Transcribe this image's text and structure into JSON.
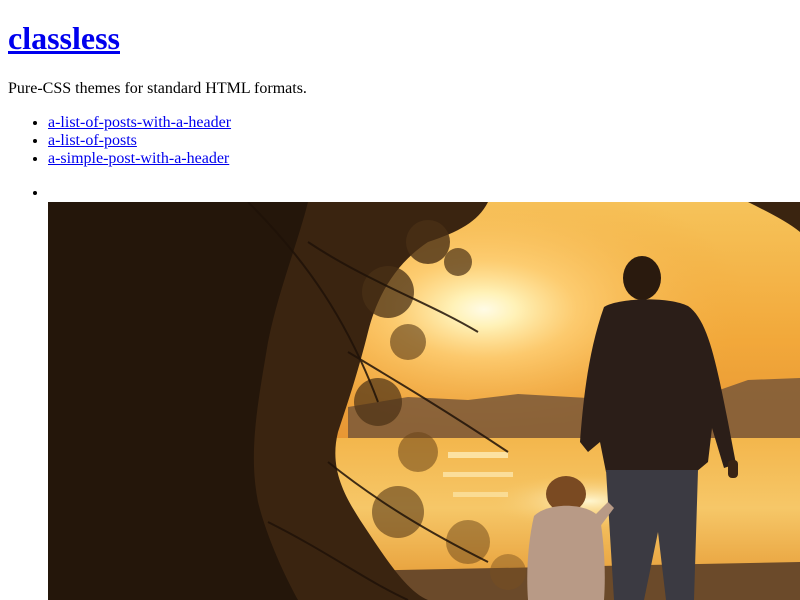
{
  "site": {
    "title": "classless",
    "tagline": "Pure-CSS themes for standard HTML formats."
  },
  "nav": {
    "items": [
      {
        "label": "a-list-of-posts-with-a-header"
      },
      {
        "label": "a-list-of-posts"
      },
      {
        "label": "a-simple-post-with-a-header"
      }
    ]
  },
  "gallery": {
    "image": {
      "icon": "sunset-photo",
      "alt": ""
    }
  },
  "colors": {
    "link": "#0000ee",
    "text": "#000000",
    "background": "#ffffff"
  }
}
